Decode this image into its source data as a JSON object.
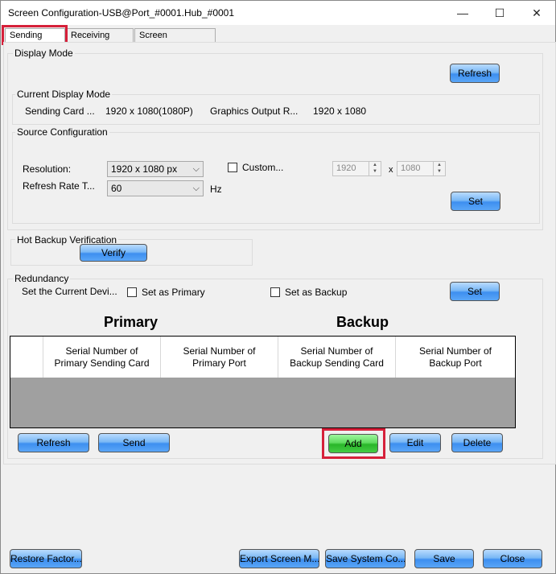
{
  "window": {
    "title": "Screen Configuration-USB@Port_#0001.Hub_#0001",
    "minimize": "—",
    "maximize": "☐",
    "close": "✕"
  },
  "tabs": [
    {
      "label": "Sending Card"
    },
    {
      "label": "Receiving Card"
    },
    {
      "label": "Screen Connection"
    }
  ],
  "display_mode": {
    "group_label": "Display Mode",
    "refresh_label": "Refresh",
    "current_label": "Current Display Mode",
    "sending_card_label": "Sending Card ...",
    "sending_card_value": "1920 x 1080(1080P)",
    "graphics_label": "Graphics Output R...",
    "graphics_value": "1920 x 1080"
  },
  "source_config": {
    "group_label": "Source Configuration",
    "resolution_label": "Resolution:",
    "resolution_value": "1920 x 1080 px",
    "custom_label": "Custom...",
    "custom_width": "1920",
    "x_label": "x",
    "custom_height": "1080",
    "refresh_rate_label": "Refresh Rate T...",
    "refresh_rate_value": "60",
    "hz_label": "Hz",
    "set_label": "Set"
  },
  "hot_backup": {
    "group_label": "Hot Backup Verification",
    "verify_label": "Verify"
  },
  "redundancy": {
    "group_label": "Redundancy",
    "set_current_label": "Set the Current Devi...",
    "primary_option": "Set as Primary",
    "backup_option": "Set as Backup",
    "set_label": "Set",
    "primary_heading": "Primary",
    "backup_heading": "Backup",
    "columns": [
      "",
      "Serial Number of Primary Sending Card",
      "Serial Number of Primary Port",
      "Serial Number of Backup Sending Card",
      "Serial Number of Backup Port"
    ],
    "refresh_label": "Refresh",
    "send_label": "Send",
    "add_label": "Add",
    "edit_label": "Edit",
    "delete_label": "Delete"
  },
  "footer": {
    "restore_label": "Restore Factor...",
    "export_label": "Export Screen M...",
    "save_system_label": "Save System Co...",
    "save_label": "Save",
    "close_label": "Close"
  },
  "colors": {
    "accent_button": "#5aa6f7",
    "add_button": "#45cc45",
    "highlight_box": "#d6203a"
  }
}
